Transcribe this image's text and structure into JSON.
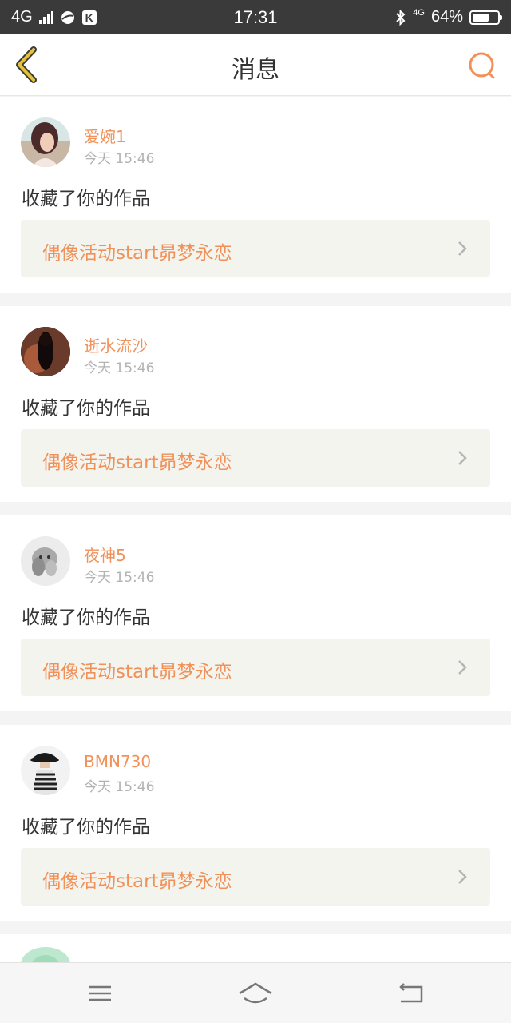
{
  "status_bar": {
    "network": "4G",
    "time": "17:31",
    "bluetooth_network": "4G",
    "battery": "64%"
  },
  "header": {
    "title": "消息"
  },
  "notifications": [
    {
      "user": "爱婉1",
      "time": "今天 15:46",
      "action": "收藏了你的作品",
      "work": "偶像活动start昴梦永恋"
    },
    {
      "user": "逝水流沙",
      "time": "今天 15:46",
      "action": "收藏了你的作品",
      "work": "偶像活动start昴梦永恋"
    },
    {
      "user": "夜神5",
      "time": "今天 15:46",
      "action": "收藏了你的作品",
      "work": "偶像活动start昴梦永恋"
    },
    {
      "user": "BMN730",
      "time": "今天 15:46",
      "action": "收藏了你的作品",
      "work": "偶像活动start昴梦永恋"
    }
  ],
  "colors": {
    "accent": "#f0915a",
    "back_icon": "#e6c23c",
    "status_bar_bg": "#3a3a3a"
  },
  "icons": {
    "back": "chevron-left-icon",
    "search": "search-icon",
    "work_link": "chevron-right-icon",
    "nav_menu": "menu-icon",
    "nav_home": "home-icon",
    "nav_back": "return-icon"
  }
}
